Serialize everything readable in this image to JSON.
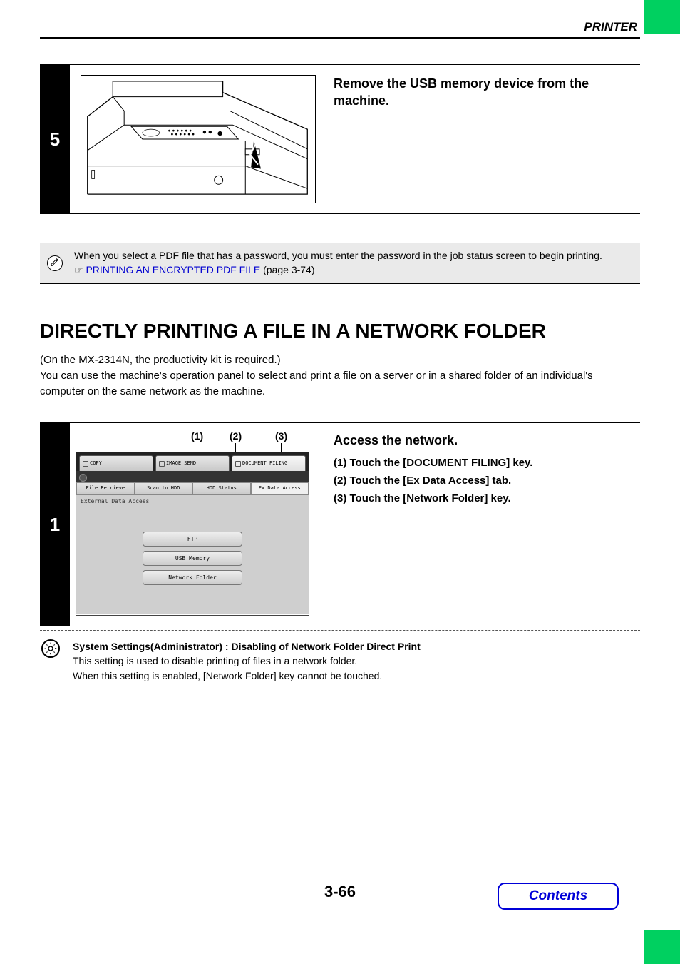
{
  "header": {
    "section": "PRINTER"
  },
  "step5": {
    "num": "5",
    "heading": "Remove the USB memory device from the machine."
  },
  "note": {
    "text_a": "When you select a PDF file that has a password, you must enter the password in the job status screen to begin printing.",
    "pointer": "☞",
    "link": "PRINTING AN ENCRYPTED PDF FILE",
    "link_suffix": " (page 3-74)"
  },
  "main": {
    "heading": "DIRECTLY PRINTING A FILE IN A NETWORK FOLDER",
    "sub1": "(On the MX-2314N, the productivity kit is required.)",
    "sub2": "You can use the machine's operation panel to select and print a file on a server or in a shared folder of an individual's computer on the same network as the machine."
  },
  "step1": {
    "num": "1",
    "callouts": {
      "c1": "(1)",
      "c2": "(2)",
      "c3": "(3)"
    },
    "heading": "Access the network.",
    "items": [
      "(1)  Touch the [DOCUMENT FILING] key.",
      "(2)  Touch the [Ex Data Access] tab.",
      "(3)  Touch the [Network Folder] key."
    ],
    "ui": {
      "top_tabs": {
        "copy": "COPY",
        "image_send": "IMAGE SEND",
        "doc_filing": "DOCUMENT FILING"
      },
      "sub_tabs": {
        "a": "File Retrieve",
        "b": "Scan to HDD",
        "c": "HDD Status",
        "d": "Ex Data Access"
      },
      "body_label": "External Data Access",
      "buttons": {
        "ftp": "FTP",
        "usb": "USB Memory",
        "net": "Network Folder"
      }
    },
    "settings": {
      "title": "System Settings(Administrator) : Disabling of Network Folder Direct Print",
      "line1": "This setting is used to disable printing of files in a network folder.",
      "line2": "When this setting is enabled, [Network Folder] key cannot be touched."
    }
  },
  "footer": {
    "page": "3-66",
    "contents": "Contents"
  }
}
